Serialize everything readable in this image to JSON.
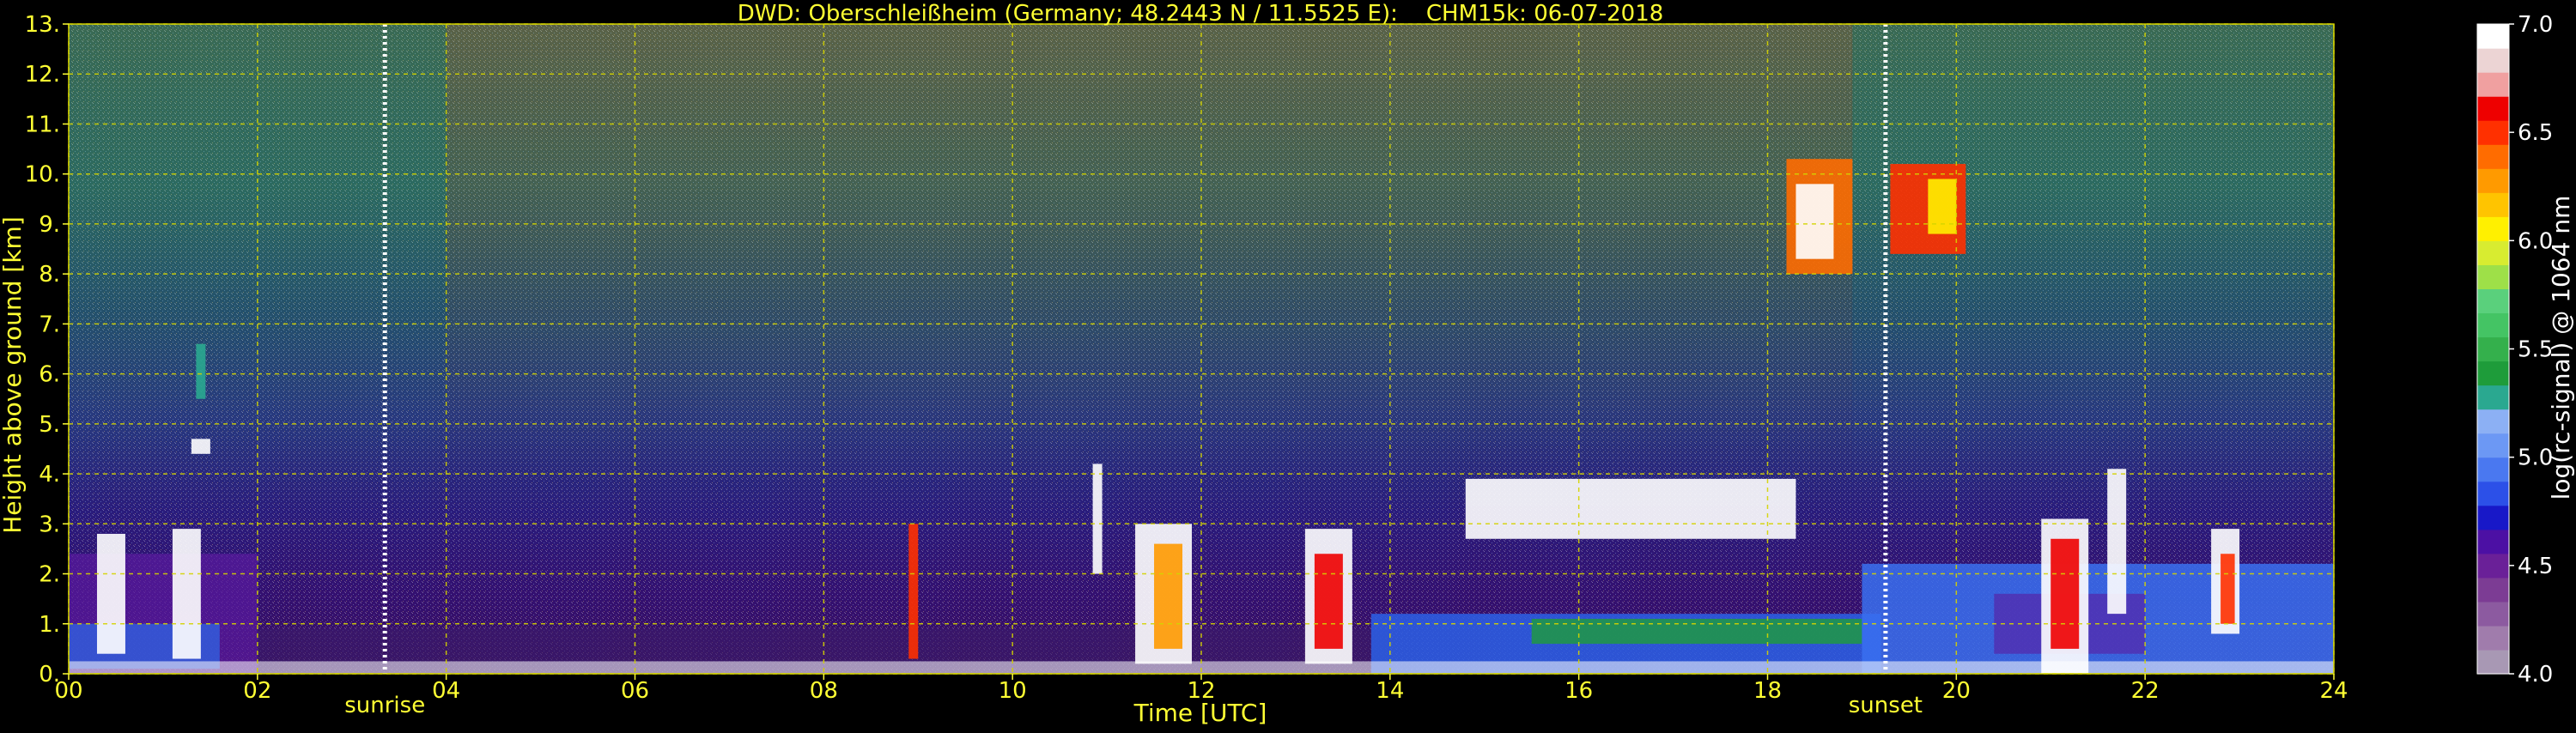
{
  "title": "DWD: Oberschleißheim (Germany; 48.2443 N / 11.5525 E):    CHM15k: 06-07-2018",
  "colors": {
    "background": "#000000",
    "text": "#ffff33",
    "colorbar_text": "#ffffff",
    "grid": "#d4d400",
    "marker": "#ffffff"
  },
  "chart_data": {
    "type": "heatmap",
    "xlabel": "Time [UTC]",
    "ylabel": "Height above ground [km]",
    "xlim": [
      0,
      24
    ],
    "ylim": [
      0,
      13
    ],
    "x_ticks": [
      "00",
      "02",
      "04",
      "06",
      "08",
      "10",
      "12",
      "14",
      "16",
      "18",
      "20",
      "22",
      "24"
    ],
    "y_ticks": [
      "0.",
      "1.",
      "2.",
      "3.",
      "4.",
      "5.",
      "6.",
      "7.",
      "8.",
      "9.",
      "10.",
      "11.",
      "12.",
      "13."
    ],
    "grid": true,
    "markers": [
      {
        "label": "sunrise",
        "x": 3.35
      },
      {
        "label": "sunset",
        "x": 19.25
      }
    ],
    "colorbar": {
      "label": "log(rc-signal) @ 1064 nm",
      "range": [
        4.0,
        7.0
      ],
      "ticks": [
        "4.0",
        "4.5",
        "5.0",
        "5.5",
        "6.0",
        "6.5",
        "7.0"
      ],
      "colors": [
        "#a898b4",
        "#a07cac",
        "#8c5aa0",
        "#7c3c94",
        "#6a2098",
        "#4c10a4",
        "#1818c8",
        "#2c50e8",
        "#4a78f0",
        "#6c98f4",
        "#8cb0f4",
        "#2aa890",
        "#1e9c3a",
        "#34b04c",
        "#44c464",
        "#5ad07c",
        "#9ee048",
        "#d8ec30",
        "#fff000",
        "#ffc400",
        "#ff9a00",
        "#ff6c00",
        "#ff3000",
        "#ee0000",
        "#f0a0a0",
        "#ecd4d4",
        "#ffffff"
      ]
    }
  }
}
